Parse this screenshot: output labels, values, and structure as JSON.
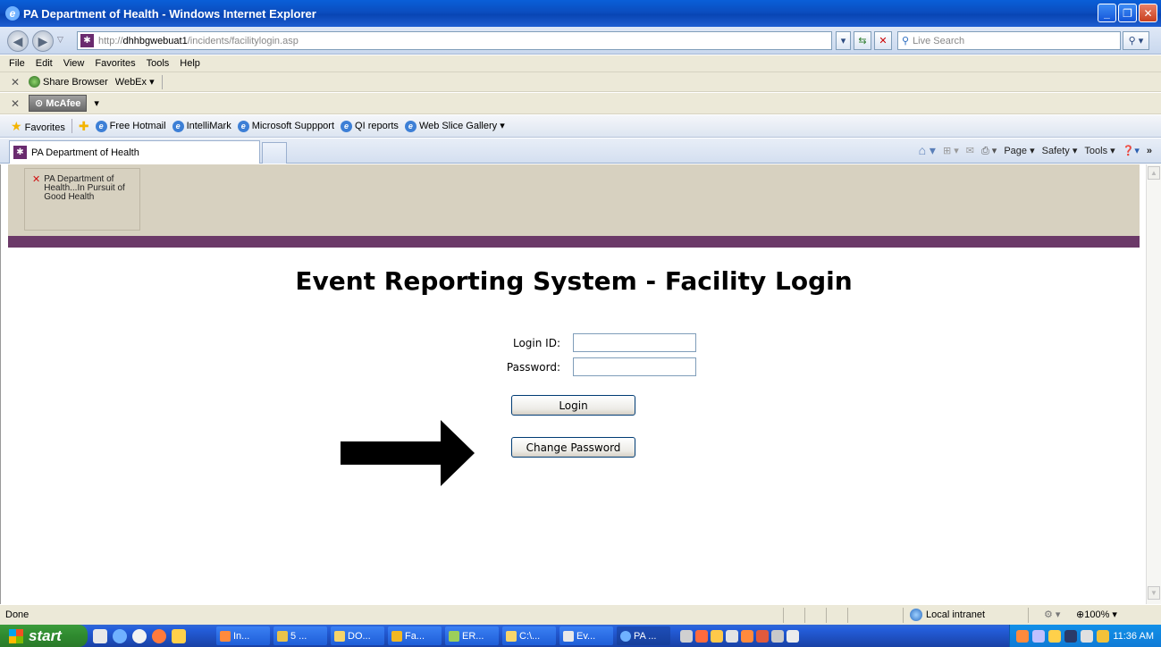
{
  "window": {
    "title": "PA Department of Health - Windows Internet Explorer"
  },
  "address_bar": {
    "url_prefix": "http://",
    "url_host": "dhhbgwebuat1",
    "url_path": "/incidents/facilitylogin.asp",
    "search_placeholder": "Live Search"
  },
  "menu": [
    "File",
    "Edit",
    "View",
    "Favorites",
    "Tools",
    "Help"
  ],
  "toolbar1": {
    "share": "Share Browser",
    "webex": "WebEx"
  },
  "toolbar2": {
    "mcafee": "McAfee"
  },
  "favorites_bar": {
    "label": "Favorites",
    "items": [
      "Free Hotmail",
      "IntelliMark",
      "Microsoft Suppport",
      "QI reports",
      "Web Slice Gallery"
    ]
  },
  "tab": {
    "title": "PA Department of Health"
  },
  "command_bar": {
    "page": "Page",
    "safety": "Safety",
    "tools": "Tools"
  },
  "page": {
    "logo_alt": "PA Department of Health...In Pursuit of Good Health",
    "heading": "Event Reporting System - Facility Login",
    "login_id_label": "Login ID:",
    "password_label": "Password:",
    "login_id_value": "",
    "password_value": "",
    "login_button": "Login",
    "change_password_button": "Change Password"
  },
  "status_bar": {
    "status": "Done",
    "zone": "Local intranet",
    "zoom": "100%"
  },
  "taskbar": {
    "start": "start",
    "tasks": [
      "In...",
      "5 ...",
      "DO...",
      "Fa...",
      "ER...",
      "C:\\...",
      "Ev...",
      "PA ..."
    ],
    "clock": "11:36 AM"
  },
  "colors": {
    "banner": "#d7d1c0",
    "purple_stripe": "#6b3968",
    "arrow": "#000000"
  }
}
